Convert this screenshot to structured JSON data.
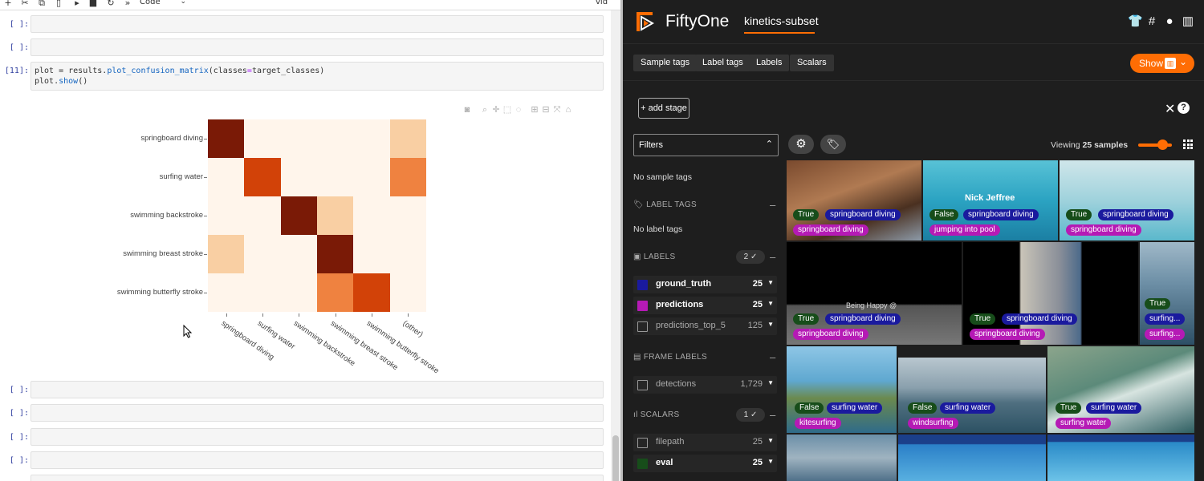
{
  "notebook": {
    "toolbar": {
      "icons": [
        "plus-icon",
        "scissors-icon",
        "copy-icon",
        "paste-icon",
        "run-icon",
        "stop-icon",
        "restart-icon",
        "fast-forward-icon"
      ],
      "cell_type": "Code",
      "right_text": "vid"
    },
    "empty_prompts": [
      "[ ]:",
      "[ ]:",
      "[ ]:",
      "[ ]:",
      "[ ]:",
      "[ ]:"
    ],
    "code_cell": {
      "prompt": "[11]:",
      "line1_a": "plot = results.",
      "line1_fn": "plot_confusion_matrix",
      "line1_b": "(classes",
      "line1_op": "=",
      "line1_c": "target_classes)",
      "line2_a": "plot.",
      "line2_fn": "show",
      "line2_b": "()"
    },
    "plot_toolbar_icons": [
      "camera-icon",
      "zoom-icon",
      "pan-icon",
      "box-select-icon",
      "lasso-icon",
      "zoom-in-icon",
      "zoom-out-icon",
      "autoscale-icon",
      "home-icon"
    ]
  },
  "chart_data": {
    "type": "heatmap",
    "y_categories": [
      "springboard diving",
      "surfing water",
      "swimming backstroke",
      "swimming breast stroke",
      "swimming butterfly stroke"
    ],
    "x_categories": [
      "springboard diving",
      "surfing water",
      "swimming backstroke",
      "swimming breast stroke",
      "swimming butterfly stroke",
      "(other)"
    ],
    "values": [
      [
        0.95,
        0.0,
        0.0,
        0.0,
        0.0,
        0.3
      ],
      [
        0.0,
        0.8,
        0.0,
        0.0,
        0.0,
        0.6
      ],
      [
        0.0,
        0.0,
        0.95,
        0.3,
        0.0,
        0.0
      ],
      [
        0.3,
        0.0,
        0.0,
        0.95,
        0.0,
        0.0
      ],
      [
        0.0,
        0.0,
        0.0,
        0.6,
        0.8,
        0.0
      ]
    ],
    "colorscale": [
      "#fff5eb",
      "#f9cfa3",
      "#ef8240",
      "#d24208",
      "#7a1a06"
    ]
  },
  "fiftyone": {
    "app_title": "FiftyOne",
    "dataset": "kinetics-subset",
    "header_icons": [
      "tshirt-icon",
      "slack-icon",
      "github-icon",
      "docs-icon"
    ],
    "tabs": [
      "Sample tags",
      "Label tags",
      "Labels",
      "Scalars"
    ],
    "show_label": "Show",
    "add_stage": "+ add stage",
    "filters_label": "Filters",
    "no_sample_tags": "No sample tags",
    "label_tags_head": "LABEL TAGS",
    "no_label_tags": "No label tags",
    "labels_head": "LABELS",
    "labels_badge": "2 ✓",
    "labels": [
      {
        "name": "ground_truth",
        "count": "25",
        "color": "#1a1a9e",
        "checked": true
      },
      {
        "name": "predictions",
        "count": "25",
        "color": "#b51ab5",
        "checked": true
      },
      {
        "name": "predictions_top_5",
        "count": "125",
        "color": "",
        "checked": false
      }
    ],
    "frame_labels_head": "FRAME LABELS",
    "frame_labels": [
      {
        "name": "detections",
        "count": "1,729",
        "checked": false
      }
    ],
    "scalars_head": "SCALARS",
    "scalars_badge": "1 ✓",
    "scalars": [
      {
        "name": "filepath",
        "count": "25",
        "checked": false
      },
      {
        "name": "eval",
        "count": "25",
        "color": "#174d1a",
        "checked": true
      }
    ],
    "viewing_prefix": "Viewing ",
    "viewing_count": "25 samples",
    "samples": [
      {
        "b": "True",
        "gt": "springboard diving",
        "pred": "springboard diving"
      },
      {
        "b": "False",
        "gt": "springboard diving",
        "pred": "jumping into pool",
        "overlay": "Nick Jeffree"
      },
      {
        "b": "True",
        "gt": "springboard diving",
        "pred": "springboard diving"
      },
      {
        "b": "True",
        "gt": "springboard diving",
        "pred": "springboard diving",
        "overlay": "Being Happy @"
      },
      {
        "b": "True",
        "gt": "springboard diving",
        "pred": "springboard diving"
      },
      {
        "b": "True",
        "gt": "surfing...",
        "pred": "surfing..."
      },
      {
        "b": "False",
        "gt": "surfing water",
        "pred": "kitesurfing"
      },
      {
        "b": "False",
        "gt": "surfing water",
        "pred": "windsurfing"
      },
      {
        "b": "True",
        "gt": "surfing water",
        "pred": "surfing water"
      }
    ]
  }
}
